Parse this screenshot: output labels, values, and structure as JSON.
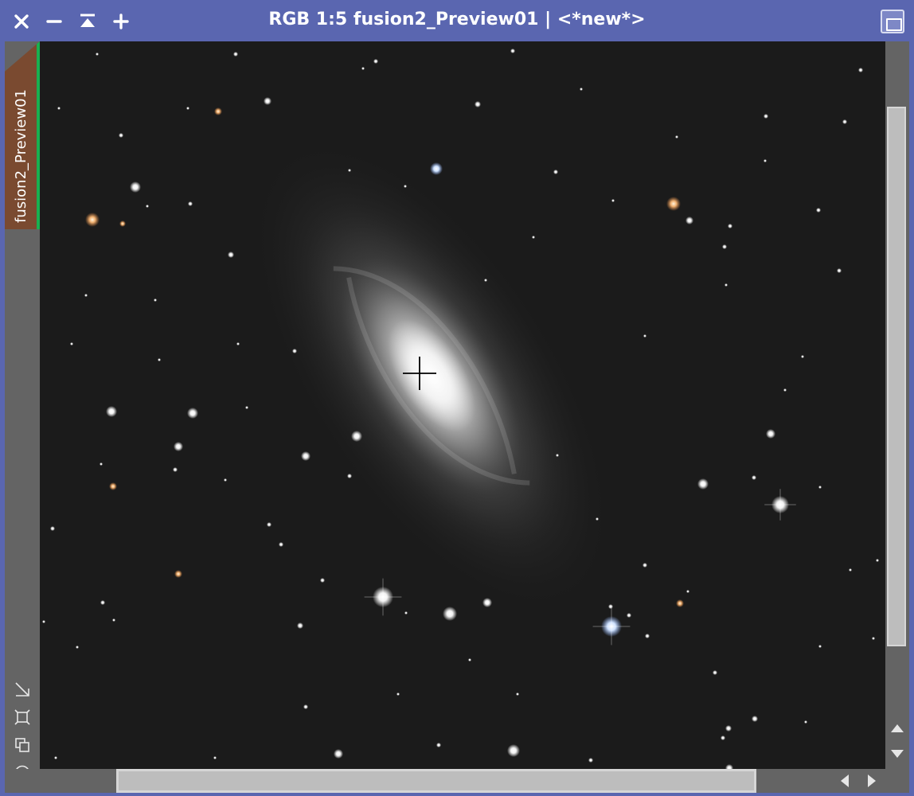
{
  "window": {
    "title": "RGB 1:5 fusion2_Preview01 | <*new*>",
    "colors": {
      "frame": "#5a66b0",
      "canvas": "#1b1b1b",
      "tab": "#7a4a30",
      "tab_accent": "#18b050"
    }
  },
  "titlebar": {
    "close_icon": "close-icon",
    "minimize_icon": "minimize-icon",
    "shade_icon": "shade-icon",
    "expand_icon": "plus-icon",
    "maximize_icon": "maximize-icon"
  },
  "sidebar": {
    "view_tab_label": "fusion2_Preview01",
    "tools": [
      "zoom-to-fit-icon",
      "fit-window-icon",
      "new-preview-icon",
      "target-icon"
    ]
  },
  "image": {
    "subject": "spiral galaxy star field",
    "cursor": "crosshair-icon"
  },
  "scrollbars": {
    "vertical": {
      "up_icon": "triangle-up-icon",
      "down_icon": "triangle-down-icon"
    },
    "horizontal": {
      "left_icon": "triangle-left-icon",
      "right_icon": "triangle-right-icon"
    }
  }
}
